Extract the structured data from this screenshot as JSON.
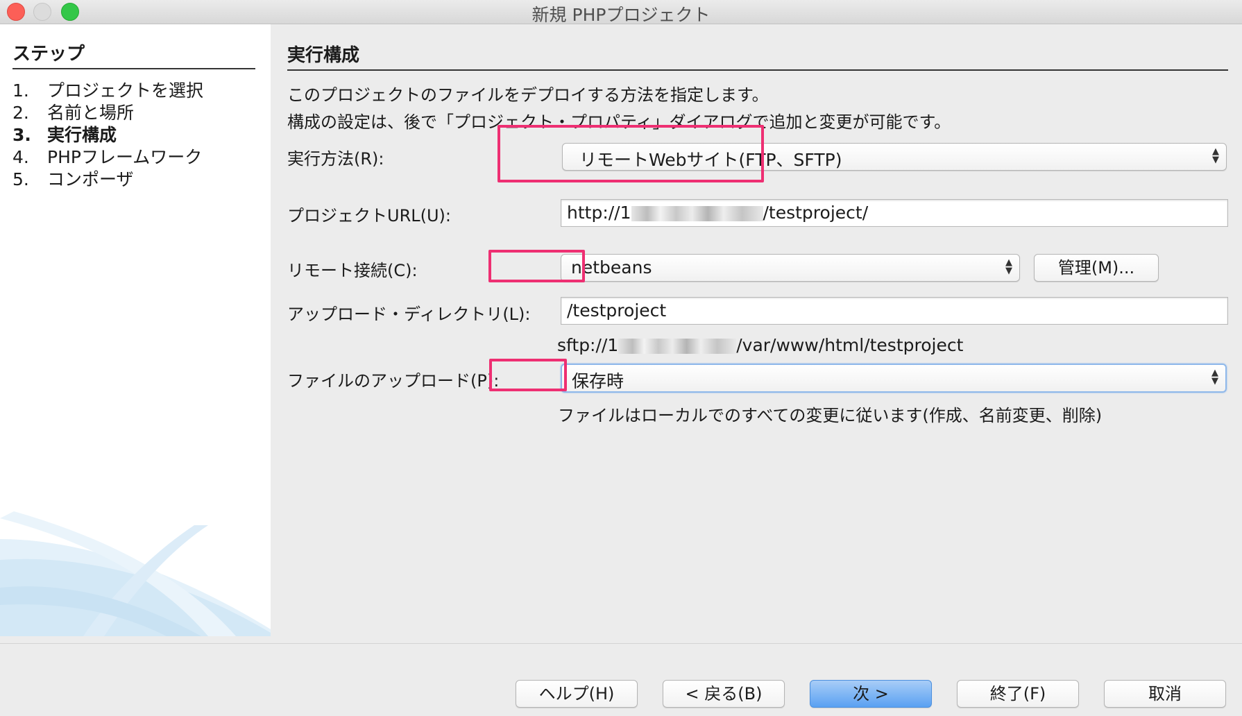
{
  "window": {
    "title": "新規 PHPプロジェクト"
  },
  "sidebar": {
    "heading": "ステップ",
    "steps": [
      {
        "num": "1.",
        "label": "プロジェクトを選択"
      },
      {
        "num": "2.",
        "label": "名前と場所"
      },
      {
        "num": "3.",
        "label": "実行構成"
      },
      {
        "num": "4.",
        "label": "PHPフレームワーク"
      },
      {
        "num": "5.",
        "label": "コンポーザ"
      }
    ],
    "current_step": 3
  },
  "main": {
    "heading": "実行構成",
    "desc_line1": "このプロジェクトのファイルをデプロイする方法を指定します。",
    "desc_line2": "構成の設定は、後で「プロジェクト・プロパティ」ダイアログで追加と変更が可能です。",
    "run_as": {
      "label": "実行方法(R):",
      "value": "リモートWebサイト(FTP、SFTP)"
    },
    "project_url": {
      "label": "プロジェクトURL(U):",
      "prefix": "http://1",
      "suffix": "/testproject/"
    },
    "remote_connection": {
      "label": "リモート接続(C):",
      "value": "netbeans",
      "manage_label": "管理(M)..."
    },
    "upload_directory": {
      "label": "アップロード・ディレクトリ(L):",
      "value": "/testproject"
    },
    "sftp_path": {
      "prefix": "sftp://1",
      "suffix": "/var/www/html/testproject"
    },
    "upload_files": {
      "label": "ファイルのアップロード(P):",
      "value": "保存時"
    },
    "upload_hint": "ファイルはローカルでのすべての変更に従います(作成、名前変更、削除)"
  },
  "footer": {
    "help": "ヘルプ(H)",
    "back": "< 戻る(B)",
    "next": "次 >",
    "finish": "終了(F)",
    "cancel": "取消"
  },
  "colors": {
    "highlight": "#ee2f72",
    "primary_button": "#5aa1f2",
    "focus_ring": "#8fb8ea"
  }
}
